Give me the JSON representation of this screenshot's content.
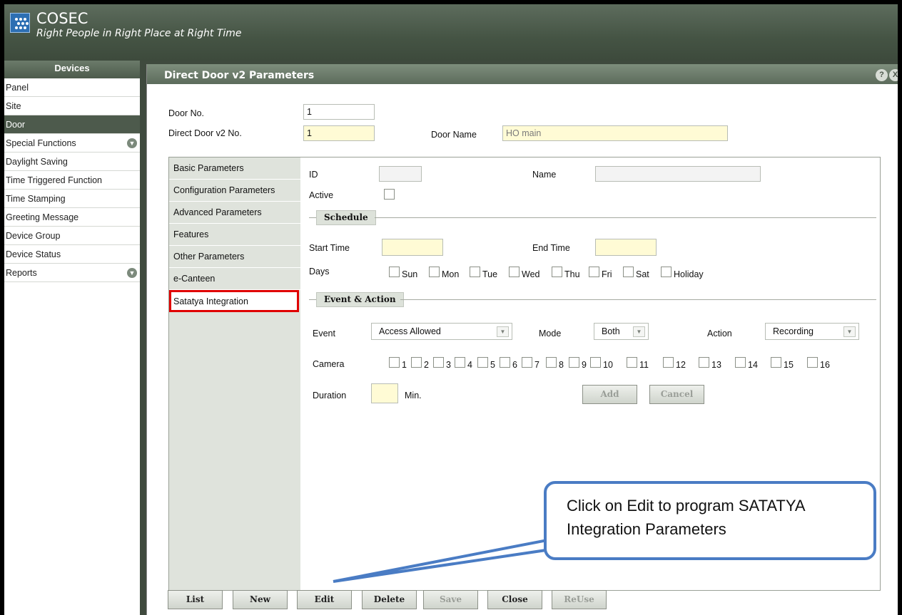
{
  "header": {
    "brand": "COSEC",
    "tagline": "Right People in Right Place at Right Time"
  },
  "sidebar": {
    "title": "Devices",
    "items": [
      {
        "label": "Panel"
      },
      {
        "label": "Site"
      },
      {
        "label": "Door",
        "selected": true
      },
      {
        "label": "Special Functions",
        "expandable": true
      },
      {
        "label": "Daylight Saving"
      },
      {
        "label": "Time Triggered Function"
      },
      {
        "label": "Time Stamping"
      },
      {
        "label": "Greeting Message"
      },
      {
        "label": "Device Group"
      },
      {
        "label": "Device Status"
      },
      {
        "label": "Reports",
        "expandable": true
      }
    ]
  },
  "panel": {
    "title": "Direct Door v2 Parameters",
    "help_icon": "?",
    "close_icon": "X",
    "door_no_label": "Door No.",
    "door_no_value": "1",
    "direct_door_label": "Direct Door v2 No.",
    "direct_door_value": "1",
    "door_name_label": "Door Name",
    "door_name_value": "HO main"
  },
  "tabs": [
    {
      "label": "Basic Parameters"
    },
    {
      "label": "Configuration Parameters"
    },
    {
      "label": "Advanced Parameters"
    },
    {
      "label": "Features"
    },
    {
      "label": "Other Parameters"
    },
    {
      "label": "e-Canteen"
    },
    {
      "label": "Satatya Integration",
      "active": true
    }
  ],
  "form": {
    "id_label": "ID",
    "id_value": "",
    "name_label": "Name",
    "name_value": "",
    "active_label": "Active",
    "schedule_title": "Schedule",
    "start_time_label": "Start Time",
    "start_time_value": "",
    "end_time_label": "End Time",
    "end_time_value": "",
    "days_label": "Days",
    "days": [
      "Sun",
      "Mon",
      "Tue",
      "Wed",
      "Thu",
      "Fri",
      "Sat",
      "Holiday"
    ],
    "event_action_title": "Event & Action",
    "event_label": "Event",
    "event_value": "Access Allowed",
    "mode_label": "Mode",
    "mode_value": "Both",
    "action_label": "Action",
    "action_value": "Recording",
    "camera_label": "Camera",
    "cameras": [
      "1",
      "2",
      "3",
      "4",
      "5",
      "6",
      "7",
      "8",
      "9",
      "10",
      "11",
      "12",
      "13",
      "14",
      "15",
      "16"
    ],
    "duration_label": "Duration",
    "duration_value": "",
    "duration_unit": "Min.",
    "add_label": "Add",
    "cancel_label": "Cancel"
  },
  "footer": {
    "buttons": [
      {
        "label": "List",
        "enabled": true
      },
      {
        "label": "New",
        "enabled": true
      },
      {
        "label": "Edit",
        "enabled": true
      },
      {
        "label": "Delete",
        "enabled": true
      },
      {
        "label": "Save",
        "enabled": false
      },
      {
        "label": "Close",
        "enabled": true
      },
      {
        "label": "ReUse",
        "enabled": false
      }
    ]
  },
  "callout": {
    "line1": "Click on Edit to program SATATYA",
    "line2": "Integration Parameters"
  },
  "colors": {
    "header_bg": "#455444",
    "selected_bg": "#4d5a4c",
    "highlight_yellow": "#fffbd5",
    "tab_highlight": "#e00000",
    "callout_border": "#4a7cc4"
  }
}
